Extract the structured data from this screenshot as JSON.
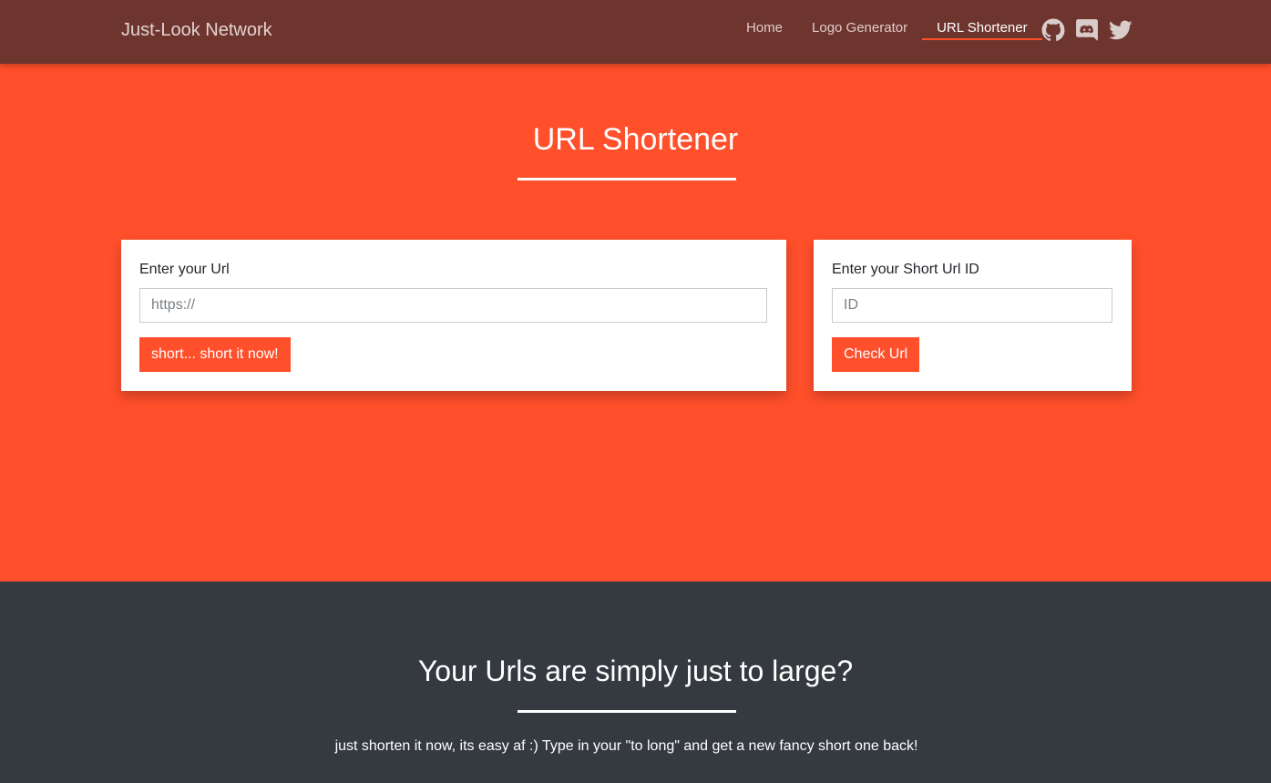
{
  "navbar": {
    "brand": "Just-Look Network",
    "links": [
      {
        "label": "Home",
        "active": false
      },
      {
        "label": "Logo Generator",
        "active": false
      },
      {
        "label": "URL Shortener",
        "active": true
      }
    ],
    "icons": [
      "github-icon",
      "discord-icon",
      "twitter-icon"
    ]
  },
  "hero": {
    "title": "URL Shortener",
    "shorten_card": {
      "label": "Enter your Url",
      "input_placeholder": "https://",
      "input_value": "",
      "button_label": "short... short it now!"
    },
    "check_card": {
      "label": "Enter your Short Url ID",
      "input_placeholder": "ID",
      "input_value": "",
      "button_label": "Check Url"
    }
  },
  "info": {
    "title": "Your Urls are simply just to large?",
    "text": "just shorten it now, its easy af :) Type in your \"to long\" and get a new fancy short one back!"
  },
  "colors": {
    "navbar_bg": "#6e352f",
    "accent": "#ff4f2b",
    "section_bg": "#343a40"
  }
}
